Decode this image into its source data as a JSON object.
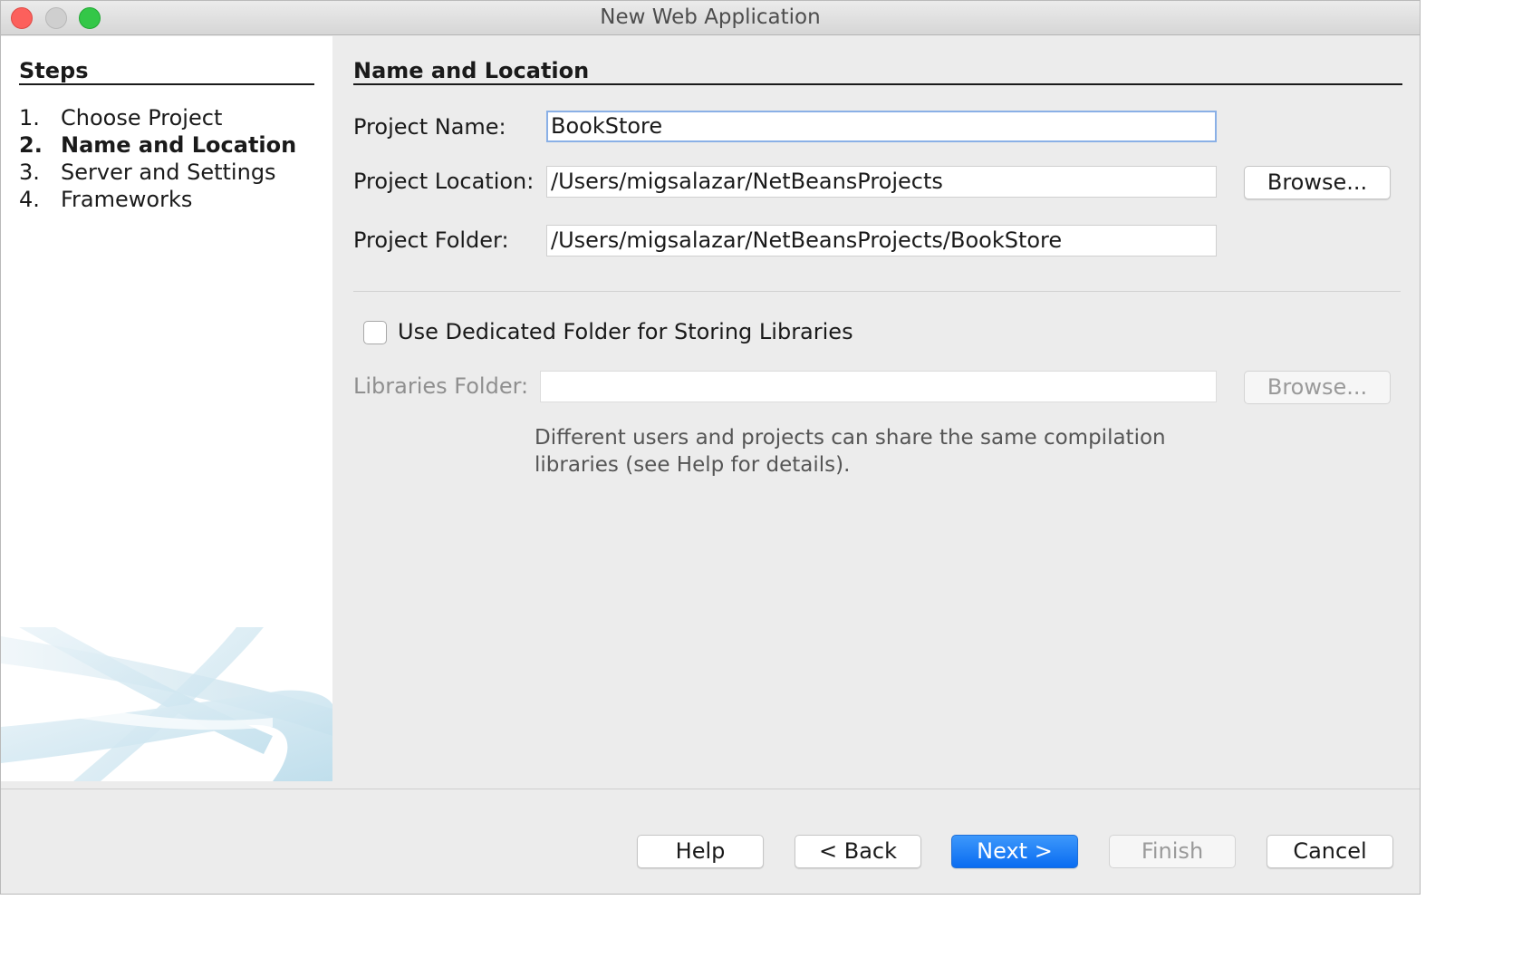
{
  "window": {
    "title": "New Web Application"
  },
  "sidebar": {
    "title": "Steps",
    "steps": [
      {
        "num": "1.",
        "label": "Choose Project"
      },
      {
        "num": "2.",
        "label": "Name and Location"
      },
      {
        "num": "3.",
        "label": "Server and Settings"
      },
      {
        "num": "4.",
        "label": "Frameworks"
      }
    ],
    "current_step": 2
  },
  "main": {
    "title": "Name and Location",
    "project_name": {
      "label": "Project Name:",
      "value": "BookStore"
    },
    "project_location": {
      "label": "Project Location:",
      "value": "/Users/migsalazar/NetBeansProjects",
      "browse_label": "Browse..."
    },
    "project_folder": {
      "label": "Project Folder:",
      "value": "/Users/migsalazar/NetBeansProjects/BookStore"
    },
    "dedicated_folder": {
      "label": "Use Dedicated Folder for Storing Libraries",
      "checked": false
    },
    "libraries_folder": {
      "label": "Libraries Folder:",
      "value": "",
      "browse_label": "Browse..."
    },
    "help_text": "Different users and projects can share the same compilation libraries (see Help for details)."
  },
  "footer": {
    "help": "Help",
    "back": "< Back",
    "next": "Next >",
    "finish": "Finish",
    "cancel": "Cancel"
  },
  "colors": {
    "primary_button": "#0a6cf1",
    "close_button": "#fc605c",
    "zoom_button": "#34c748",
    "focus_ring": "#8ab0e6"
  }
}
